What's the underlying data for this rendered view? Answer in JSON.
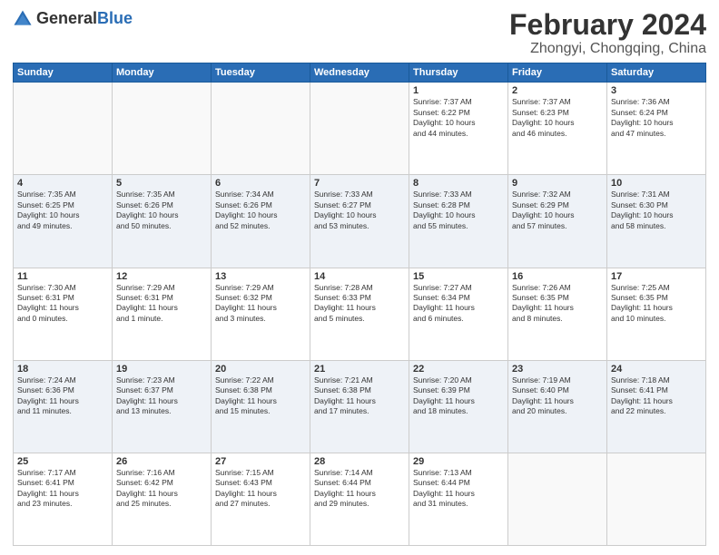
{
  "logo": {
    "general": "General",
    "blue": "Blue"
  },
  "header": {
    "month": "February 2024",
    "location": "Zhongyi, Chongqing, China"
  },
  "weekdays": [
    "Sunday",
    "Monday",
    "Tuesday",
    "Wednesday",
    "Thursday",
    "Friday",
    "Saturday"
  ],
  "weeks": [
    [
      {
        "day": "",
        "info": ""
      },
      {
        "day": "",
        "info": ""
      },
      {
        "day": "",
        "info": ""
      },
      {
        "day": "",
        "info": ""
      },
      {
        "day": "1",
        "info": "Sunrise: 7:37 AM\nSunset: 6:22 PM\nDaylight: 10 hours\nand 44 minutes."
      },
      {
        "day": "2",
        "info": "Sunrise: 7:37 AM\nSunset: 6:23 PM\nDaylight: 10 hours\nand 46 minutes."
      },
      {
        "day": "3",
        "info": "Sunrise: 7:36 AM\nSunset: 6:24 PM\nDaylight: 10 hours\nand 47 minutes."
      }
    ],
    [
      {
        "day": "4",
        "info": "Sunrise: 7:35 AM\nSunset: 6:25 PM\nDaylight: 10 hours\nand 49 minutes."
      },
      {
        "day": "5",
        "info": "Sunrise: 7:35 AM\nSunset: 6:26 PM\nDaylight: 10 hours\nand 50 minutes."
      },
      {
        "day": "6",
        "info": "Sunrise: 7:34 AM\nSunset: 6:26 PM\nDaylight: 10 hours\nand 52 minutes."
      },
      {
        "day": "7",
        "info": "Sunrise: 7:33 AM\nSunset: 6:27 PM\nDaylight: 10 hours\nand 53 minutes."
      },
      {
        "day": "8",
        "info": "Sunrise: 7:33 AM\nSunset: 6:28 PM\nDaylight: 10 hours\nand 55 minutes."
      },
      {
        "day": "9",
        "info": "Sunrise: 7:32 AM\nSunset: 6:29 PM\nDaylight: 10 hours\nand 57 minutes."
      },
      {
        "day": "10",
        "info": "Sunrise: 7:31 AM\nSunset: 6:30 PM\nDaylight: 10 hours\nand 58 minutes."
      }
    ],
    [
      {
        "day": "11",
        "info": "Sunrise: 7:30 AM\nSunset: 6:31 PM\nDaylight: 11 hours\nand 0 minutes."
      },
      {
        "day": "12",
        "info": "Sunrise: 7:29 AM\nSunset: 6:31 PM\nDaylight: 11 hours\nand 1 minute."
      },
      {
        "day": "13",
        "info": "Sunrise: 7:29 AM\nSunset: 6:32 PM\nDaylight: 11 hours\nand 3 minutes."
      },
      {
        "day": "14",
        "info": "Sunrise: 7:28 AM\nSunset: 6:33 PM\nDaylight: 11 hours\nand 5 minutes."
      },
      {
        "day": "15",
        "info": "Sunrise: 7:27 AM\nSunset: 6:34 PM\nDaylight: 11 hours\nand 6 minutes."
      },
      {
        "day": "16",
        "info": "Sunrise: 7:26 AM\nSunset: 6:35 PM\nDaylight: 11 hours\nand 8 minutes."
      },
      {
        "day": "17",
        "info": "Sunrise: 7:25 AM\nSunset: 6:35 PM\nDaylight: 11 hours\nand 10 minutes."
      }
    ],
    [
      {
        "day": "18",
        "info": "Sunrise: 7:24 AM\nSunset: 6:36 PM\nDaylight: 11 hours\nand 11 minutes."
      },
      {
        "day": "19",
        "info": "Sunrise: 7:23 AM\nSunset: 6:37 PM\nDaylight: 11 hours\nand 13 minutes."
      },
      {
        "day": "20",
        "info": "Sunrise: 7:22 AM\nSunset: 6:38 PM\nDaylight: 11 hours\nand 15 minutes."
      },
      {
        "day": "21",
        "info": "Sunrise: 7:21 AM\nSunset: 6:38 PM\nDaylight: 11 hours\nand 17 minutes."
      },
      {
        "day": "22",
        "info": "Sunrise: 7:20 AM\nSunset: 6:39 PM\nDaylight: 11 hours\nand 18 minutes."
      },
      {
        "day": "23",
        "info": "Sunrise: 7:19 AM\nSunset: 6:40 PM\nDaylight: 11 hours\nand 20 minutes."
      },
      {
        "day": "24",
        "info": "Sunrise: 7:18 AM\nSunset: 6:41 PM\nDaylight: 11 hours\nand 22 minutes."
      }
    ],
    [
      {
        "day": "25",
        "info": "Sunrise: 7:17 AM\nSunset: 6:41 PM\nDaylight: 11 hours\nand 23 minutes."
      },
      {
        "day": "26",
        "info": "Sunrise: 7:16 AM\nSunset: 6:42 PM\nDaylight: 11 hours\nand 25 minutes."
      },
      {
        "day": "27",
        "info": "Sunrise: 7:15 AM\nSunset: 6:43 PM\nDaylight: 11 hours\nand 27 minutes."
      },
      {
        "day": "28",
        "info": "Sunrise: 7:14 AM\nSunset: 6:44 PM\nDaylight: 11 hours\nand 29 minutes."
      },
      {
        "day": "29",
        "info": "Sunrise: 7:13 AM\nSunset: 6:44 PM\nDaylight: 11 hours\nand 31 minutes."
      },
      {
        "day": "",
        "info": ""
      },
      {
        "day": "",
        "info": ""
      }
    ]
  ]
}
